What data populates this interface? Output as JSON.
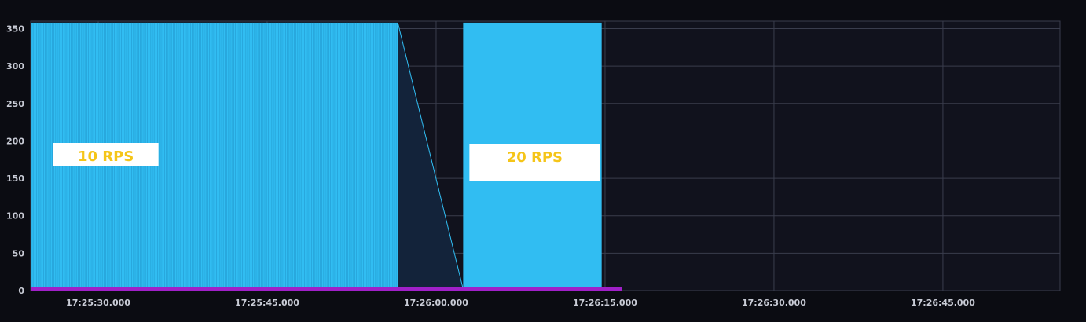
{
  "chart_data": {
    "type": "area",
    "y_ticks": [
      0,
      50,
      100,
      150,
      200,
      250,
      300,
      350
    ],
    "ylim": [
      0,
      360
    ],
    "x_ticks": [
      "17:25:30.000",
      "17:25:45.000",
      "17:26:00.000",
      "17:26:15.000",
      "17:26:30.000",
      "17:26:45.000"
    ],
    "x_tick_seconds": [
      30,
      45,
      60,
      75,
      90,
      105
    ],
    "xlim_seconds": [
      24,
      115.4
    ],
    "grid": true,
    "series": [
      {
        "color": "#31bdf2",
        "segments": [
          {
            "x_start": 24,
            "x_end": 56.6,
            "y": 358,
            "oscillating": true
          },
          {
            "x_start": 62.4,
            "x_end": 74.7,
            "y": 358,
            "oscillating": false
          }
        ],
        "transition": {
          "x_start": 56.6,
          "y_start": 358,
          "x_end": 62.4,
          "y_end": 2
        }
      },
      {
        "color": "#a020c8",
        "x_start": 24,
        "x_end": 76.5,
        "y": 2
      }
    ],
    "annotations": [
      {
        "text": "10 RPS",
        "x": 26,
        "y": 190
      },
      {
        "text": "20 RPS",
        "x": 65,
        "y": 185
      }
    ],
    "colors": {
      "background": "#0b0c12",
      "plot_background": "#11121d",
      "grid": "#3a3d4d",
      "gap_fill": "#13233a",
      "annotation_box": "#ffffff",
      "annotation_text": "#f5c518"
    }
  }
}
